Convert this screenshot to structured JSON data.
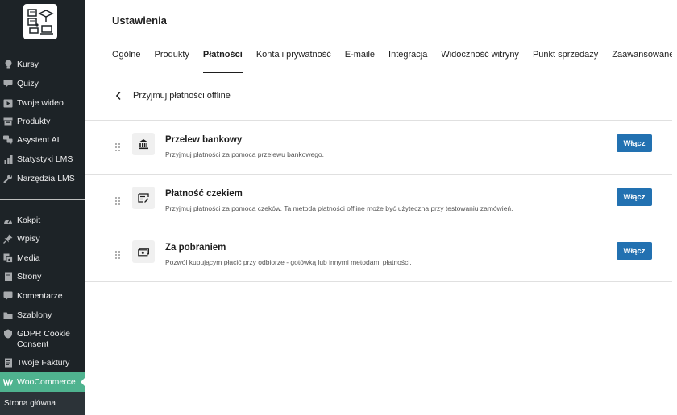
{
  "sidebar": {
    "items_top": [
      {
        "label": "Kursy",
        "icon": "lightbulb-icon"
      },
      {
        "label": "Quizy",
        "icon": "chat-icon"
      },
      {
        "label": "Twoje wideo",
        "icon": "video-icon"
      },
      {
        "label": "Produkty",
        "icon": "archive-icon"
      },
      {
        "label": "Asystent AI",
        "icon": "bubbles-icon"
      },
      {
        "label": "Statystyki LMS",
        "icon": "bar-chart-icon"
      },
      {
        "label": "Narzędzia LMS",
        "icon": "wrench-icon"
      }
    ],
    "items_bottom": [
      {
        "label": "Kokpit",
        "icon": "dashboard-icon"
      },
      {
        "label": "Wpisy",
        "icon": "pin-icon"
      },
      {
        "label": "Media",
        "icon": "media-icon"
      },
      {
        "label": "Strony",
        "icon": "page-icon"
      },
      {
        "label": "Komentarze",
        "icon": "comment-icon"
      },
      {
        "label": "Szablony",
        "icon": "folder-icon"
      },
      {
        "label": "GDPR Cookie Consent",
        "icon": "shield-icon"
      },
      {
        "label": "Twoje Faktury",
        "icon": "invoice-icon"
      },
      {
        "label": "WooCommerce",
        "icon": "woo-icon"
      }
    ],
    "submenu_label": "Strona główna"
  },
  "page": {
    "title": "Ustawienia",
    "tabs": [
      "Ogólne",
      "Produkty",
      "Płatności",
      "Konta i prywatność",
      "E-maile",
      "Integracja",
      "Widoczność witryny",
      "Punkt sprzedaży",
      "Zaawansowane"
    ],
    "active_tab": "Płatności",
    "sub_title": "Przyjmuj płatności offline"
  },
  "methods": [
    {
      "title": "Przelew bankowy",
      "desc": "Przyjmuj płatności za pomocą przelewu bankowego.",
      "button": "Włącz",
      "icon": "bank-icon"
    },
    {
      "title": "Płatność czekiem",
      "desc": "Przyjmuj płatności za pomocą czeków. Ta metoda płatności offline może być użyteczna przy testowaniu zamówień.",
      "button": "Włącz",
      "icon": "cheque-icon"
    },
    {
      "title": "Za pobraniem",
      "desc": "Pozwól kupującym płacić przy odbiorze - gotówką lub innymi metodami płatności.",
      "button": "Włącz",
      "icon": "cash-icon"
    }
  ],
  "colors": {
    "sidebar_bg": "#1d2327",
    "woo_active": "#4fb38f",
    "button_blue": "#2271b1"
  }
}
